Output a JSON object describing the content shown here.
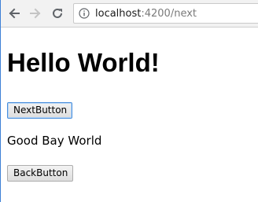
{
  "browser": {
    "url_host": "localhost",
    "url_rest": ":4200/next"
  },
  "page": {
    "heading": "Hello World!",
    "next_button_label": "NextButton",
    "message": "Good Bay World",
    "back_button_label": "BackButton"
  },
  "icons": {
    "back": "arrow-left-icon",
    "forward": "arrow-right-icon",
    "reload": "reload-icon",
    "info": "info-icon"
  },
  "colors": {
    "toolbar_background": "#f2f2f2",
    "nav_icon": "#5f6368",
    "nav_icon_disabled": "#c4c4c4",
    "focus_border": "#4a8fdc",
    "window_edge": "#3d80d6"
  }
}
